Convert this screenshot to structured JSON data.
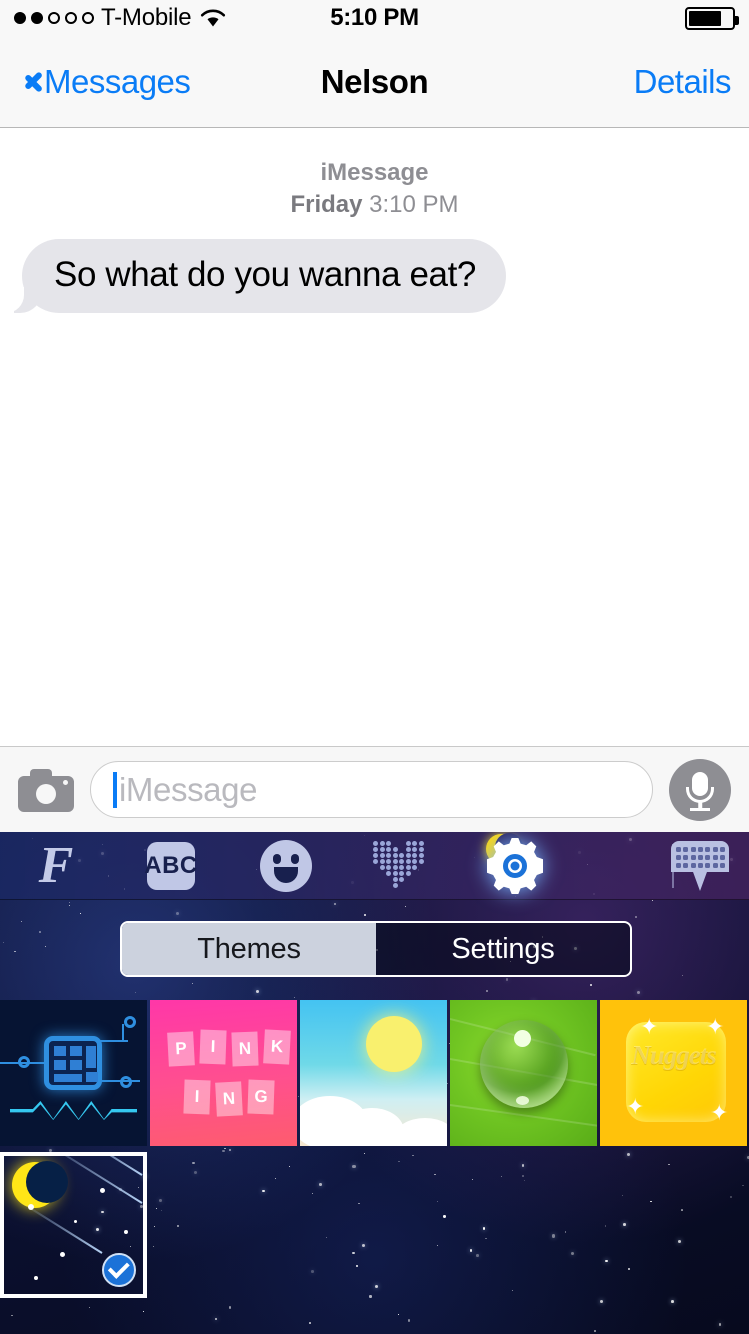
{
  "status_bar": {
    "carrier": "T-Mobile",
    "signal_dots_filled": 2,
    "signal_dots_total": 5,
    "wifi_icon": "wifi-icon",
    "time": "5:10 PM",
    "battery_icon": "battery-icon",
    "battery_level_percent": 75
  },
  "nav_bar": {
    "back_icon": "chevron-left-icon",
    "back_label": "Messages",
    "title": "Nelson",
    "details_label": "Details"
  },
  "conversation": {
    "service_label": "iMessage",
    "day_label": "Friday",
    "time_label": "3:10 PM",
    "messages": [
      {
        "text": "So what do you wanna eat?",
        "side": "incoming"
      }
    ]
  },
  "input_bar": {
    "camera_icon": "camera-icon",
    "placeholder": "iMessage",
    "value": "",
    "mic_icon": "microphone-icon"
  },
  "keyboard": {
    "toolbar": [
      {
        "name": "fonts-icon",
        "label": "F",
        "active": false
      },
      {
        "name": "abc-icon",
        "label": "ABC",
        "active": false
      },
      {
        "name": "emoji-icon",
        "label": "",
        "active": false
      },
      {
        "name": "dot-art-icon",
        "label": "",
        "active": false
      },
      {
        "name": "gear-icon",
        "label": "",
        "active": true
      },
      {
        "name": "keyboard-icon",
        "label": "",
        "active": false
      }
    ],
    "segmented_control": {
      "selected": "Themes",
      "options": [
        "Themes",
        "Settings"
      ]
    },
    "themes": [
      {
        "name": "circuit",
        "selected": false
      },
      {
        "name": "pinking",
        "label_top": "PINK",
        "label_bottom": "ING",
        "selected": false
      },
      {
        "name": "sky",
        "selected": false
      },
      {
        "name": "leaf-droplet",
        "selected": false
      },
      {
        "name": "nuggets",
        "label": "Nuggets",
        "selected": false
      },
      {
        "name": "night-sky",
        "selected": true
      }
    ],
    "selected_theme_check_icon": "check-circle-icon"
  },
  "colors": {
    "accent_blue": "#0a7cf6",
    "bubble_gray": "#e5e5ea",
    "bar_gray": "#f8f8f8",
    "check_blue": "#1b72d8",
    "moon_yellow": "#ffe617"
  }
}
